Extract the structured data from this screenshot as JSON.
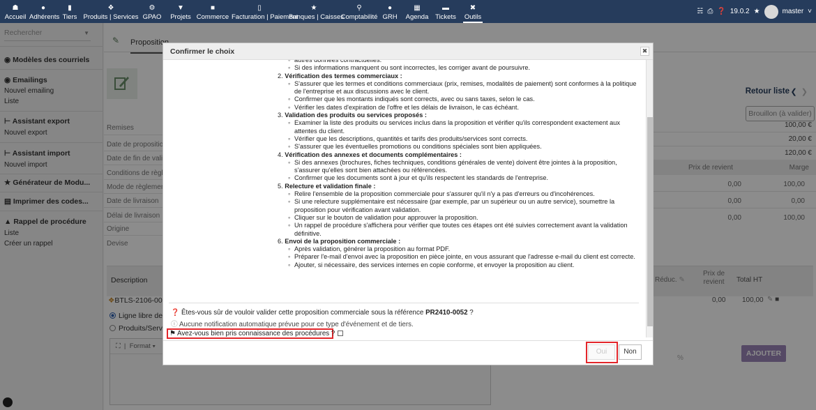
{
  "navbar": {
    "items": [
      {
        "label": "Accueil",
        "icon": "home-icon"
      },
      {
        "label": "Adhérents",
        "icon": "user-icon"
      },
      {
        "label": "Tiers",
        "icon": "building-icon"
      },
      {
        "label": "Produits | Services",
        "icon": "cube-icon"
      },
      {
        "label": "GPAO",
        "icon": "cogs-icon"
      },
      {
        "label": "Projets",
        "icon": "sitemap-icon"
      },
      {
        "label": "Commerce",
        "icon": "suitcase-icon"
      },
      {
        "label": "Facturation | Paiement",
        "icon": "file-icon"
      },
      {
        "label": "Banques | Caisses",
        "icon": "bank-icon"
      },
      {
        "label": "Comptabilité",
        "icon": "search-dollar-icon"
      },
      {
        "label": "GRH",
        "icon": "user-tie-icon"
      },
      {
        "label": "Agenda",
        "icon": "calendar-icon"
      },
      {
        "label": "Tickets",
        "icon": "ticket-icon"
      },
      {
        "label": "Outils",
        "icon": "tools-icon"
      }
    ],
    "version": "19.0.2",
    "user": "master"
  },
  "sidebar": {
    "search_placeholder": "Rechercher",
    "sections": [
      {
        "title": "Modèles des courriels",
        "links": []
      },
      {
        "title": "Emailings",
        "links": [
          "Nouvel emailing",
          "Liste"
        ]
      },
      {
        "title": "Assistant export",
        "links": [
          "Nouvel export"
        ]
      },
      {
        "title": "Assistant import",
        "links": [
          "Nouvel import"
        ]
      },
      {
        "title": "Générateur de Modu...",
        "links": []
      },
      {
        "title": "Imprimer des codes...",
        "links": []
      },
      {
        "title": "Rappel de procédure",
        "links": [
          "Liste",
          "Créer un rappel"
        ]
      }
    ]
  },
  "main": {
    "tab_label": "Proposition",
    "retour_label": "Retour liste",
    "status": "Brouillon (à valider)",
    "fields": [
      "Remises",
      "Date de proposition",
      "Date de fin de valid",
      "Conditions de règle",
      "Mode de règlement",
      "Date de livraison",
      "Délai de livraison",
      "Origine",
      "Devise"
    ],
    "amounts": [
      "100,00 €",
      "20,00 €",
      "120,00 €"
    ],
    "line_headers": {
      "prix_revient": "Prix de revient",
      "marge": "Marge"
    },
    "line_rows": [
      {
        "prix_revient": "0,00",
        "marge": "100,00"
      },
      {
        "prix_revient": "0,00",
        "marge": "0,00"
      },
      {
        "prix_revient": "0,00",
        "marge": "100,00"
      }
    ],
    "desc_header": {
      "description": "Description",
      "reduc": "Réduc.",
      "prix_de": "Prix de",
      "revient": "revient",
      "total_ht": "Total HT"
    },
    "product_row": {
      "ref": "BTLS-2106-002",
      "prix": "0,00",
      "total": "100,00"
    },
    "radio_ligne_libre": "Ligne libre de t",
    "radio_produits": "Produits/Servic",
    "editor_format": "Format",
    "pct_symbol": "%",
    "ajouter_label": "AJOUTER"
  },
  "modal": {
    "title": "Confirmer le choix",
    "procedure": [
      {
        "type": "bullet",
        "text": "autres données contractuelles."
      },
      {
        "type": "bullet",
        "text": "Si des informations manquent ou sont incorrectes, les corriger avant de poursuivre."
      },
      {
        "type": "heading",
        "num": "2. ",
        "text": "Vérification des termes commerciaux :"
      },
      {
        "type": "bullet",
        "text": "S'assurer que les termes et conditions commerciaux (prix, remises, modalités de paiement) sont conformes à la politique de l'entreprise et aux discussions avec le client."
      },
      {
        "type": "bullet",
        "text": "Confirmer que les montants indiqués sont corrects, avec ou sans taxes, selon le cas."
      },
      {
        "type": "bullet",
        "text": "Vérifier les dates d'expiration de l'offre et les délais de livraison, le cas échéant."
      },
      {
        "type": "heading",
        "num": "3. ",
        "text": "Validation des produits ou services proposés :"
      },
      {
        "type": "bullet",
        "text": "Examiner la liste des produits ou services inclus dans la proposition et vérifier qu'ils correspondent exactement aux attentes du client."
      },
      {
        "type": "bullet",
        "text": "Vérifier que les descriptions, quantités et tarifs des produits/services sont corrects."
      },
      {
        "type": "bullet",
        "text": "S'assurer que les éventuelles promotions ou conditions spéciales sont bien appliquées."
      },
      {
        "type": "heading",
        "num": "4. ",
        "text": "Vérification des annexes et documents complémentaires :"
      },
      {
        "type": "bullet",
        "text": "Si des annexes (brochures, fiches techniques, conditions générales de vente) doivent être jointes à la proposition, s'assurer qu'elles sont bien attachées ou référencées."
      },
      {
        "type": "bullet",
        "text": "Confirmer que les documents sont à jour et qu'ils respectent les standards de l'entreprise."
      },
      {
        "type": "heading",
        "num": "5. ",
        "text": "Relecture et validation finale :"
      },
      {
        "type": "bullet",
        "text": "Relire l'ensemble de la proposition commerciale pour s'assurer qu'il n'y a pas d'erreurs ou d'incohérences."
      },
      {
        "type": "bullet",
        "text": "Si une relecture supplémentaire est nécessaire (par exemple, par un supérieur ou un autre service), soumettre la proposition pour vérification avant validation."
      },
      {
        "type": "bullet",
        "text": "Cliquer sur le bouton de validation pour approuver la proposition."
      },
      {
        "type": "bullet",
        "text": "Un rappel de procédure s'affichera pour vérifier que toutes ces étapes ont été suivies correctement avant la validation définitive."
      },
      {
        "type": "heading",
        "num": "6. ",
        "text": "Envoi de la proposition commerciale :"
      },
      {
        "type": "bullet",
        "text": "Après validation, générer la proposition au format PDF."
      },
      {
        "type": "bullet",
        "text": "Préparer l'e-mail d'envoi avec la proposition en pièce jointe, en vous assurant que l'adresse e-mail du client est correcte."
      },
      {
        "type": "bullet",
        "text": "Ajouter, si nécessaire, des services internes en copie conforme, et envoyer la proposition au client."
      }
    ],
    "question_prefix": "Êtes-vous sûr de vouloir valider cette proposition commerciale sous la référence ",
    "question_ref": "PR2410-0052",
    "question_suffix": " ?",
    "notification_text": "Aucune notification automatique prévue pour ce type d'événement et de tiers.",
    "checkbox_label": "Avez-vous bien pris connaissance des procédures ?",
    "oui_label": "Oui",
    "non_label": "Non"
  },
  "colors": {
    "navbar": "#263c5c",
    "accent_red": "#e3262b",
    "ajouter": "#9b86b8"
  }
}
